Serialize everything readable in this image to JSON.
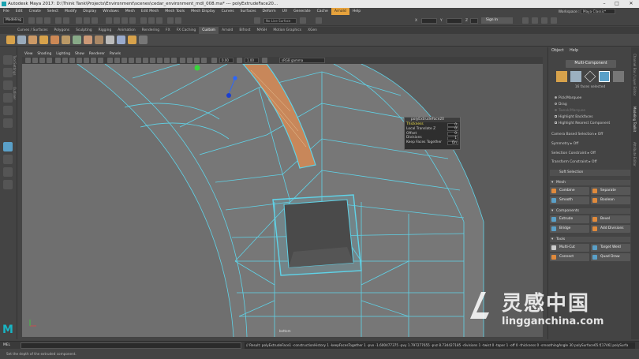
{
  "titlebar": {
    "text": "Autodesk Maya 2017: D:\\Think Tank\\Projects\\Environment\\scenes\\cedar_environment_mdl_008.ma* --- polyExtrudeFace20..."
  },
  "menu": {
    "items": [
      "File",
      "Edit",
      "Create",
      "Select",
      "Modify",
      "Display",
      "Windows",
      "Mesh",
      "Edit Mesh",
      "Mesh Tools",
      "Mesh Display",
      "Curves",
      "Surfaces",
      "Deform",
      "UV",
      "Generate",
      "Cache",
      "Arnold",
      "Help"
    ],
    "highlighted": "Arnold",
    "workspace_label": "Workspace :",
    "workspace_value": "Maya Classic*"
  },
  "status_line": {
    "mode": "Modeling",
    "live_surface": "No Live Surface",
    "x_label": "X",
    "y_label": "Y",
    "z_label": "Z",
    "sign_in": "Sign In"
  },
  "shelf": {
    "tabs": [
      "Curves / Surfaces",
      "Polygons",
      "Sculpting",
      "Rigging",
      "Animation",
      "Rendering",
      "FX",
      "FX Caching",
      "Custom",
      "Arnold",
      "Bifrost",
      "MASH",
      "Motion Graphics",
      "XGen"
    ],
    "active_tab": "Custom"
  },
  "viewport": {
    "menu": [
      "View",
      "Shading",
      "Lighting",
      "Show",
      "Renderer",
      "Panels"
    ],
    "field_near": "0.00",
    "field_far": "1.00",
    "color_space": "sRGB gamma",
    "camera_label": "bottom"
  },
  "hud": {
    "title": "polyExtrudeFace20",
    "rows": [
      {
        "label": "Thickness",
        "value": "0"
      },
      {
        "label": "Local Translate Z",
        "value": "0"
      },
      {
        "label": "Offset",
        "value": "0"
      },
      {
        "label": "Divisions",
        "value": "1"
      },
      {
        "label": "Keep Faces Together",
        "value": "On"
      }
    ]
  },
  "modeling_toolkit": {
    "menu": [
      "Object",
      "Help"
    ],
    "title": "Multi-Component",
    "faces_selected": "16 faces selected",
    "options": [
      {
        "label": "Pick/Marquee",
        "state": "radio-on"
      },
      {
        "label": "Drag",
        "state": "radio-off"
      },
      {
        "label": "Tweak/Marquee",
        "state": "dim"
      },
      {
        "label": "Highlight Backfaces",
        "state": "check"
      },
      {
        "label": "Highlight Nearest Component",
        "state": "check"
      }
    ],
    "dropdowns": [
      {
        "label": "Camera Based Selection",
        "value": "Off"
      },
      {
        "label": "Symmetry",
        "value": "Off"
      },
      {
        "label": "Selection Constraint",
        "value": "Off"
      },
      {
        "label": "Transform Constraint",
        "value": "Off"
      }
    ],
    "soft_selection": "Soft Selection",
    "sections": {
      "mesh": "Mesh",
      "components": "Components",
      "tools": "Tools"
    },
    "mesh_buttons": [
      "Combine",
      "Separate",
      "Smooth",
      "Boolean"
    ],
    "component_buttons": [
      "Extrude",
      "Bevel",
      "Bridge",
      "Add Divisions"
    ],
    "tool_buttons": [
      "Multi-Cut",
      "Target Weld",
      "Connect",
      "Quad Draw"
    ]
  },
  "side_tabs": [
    "Channel Box / Layer Editor",
    "Modeling Toolkit",
    "Attribute Editor"
  ],
  "left_tabs": [
    "Tool Settings",
    "Outliner"
  ],
  "command_line": {
    "label": "MEL",
    "result": "// Result: polyExtrudeFace1 -constructionHistory 1 -keepFacesTogether 1 -pvx -1.600477375 -pvy 1.797277655 -pvz 8.734427185 -divisions 1 -twist 0 -taper 1 -off 0 -thickness 0 -smoothingAngle 30 polySurface65.f[1746] polySurfa"
  },
  "help_line": "Set the depth of the extruded component.",
  "watermark": {
    "cn": "灵感中国",
    "en": "lingganchina.com"
  },
  "colors": {
    "accent": "#e6a23c",
    "mesh_wire": "#5fd3e8",
    "selected_face": "#c8875a",
    "viewport_bg": "#6b6b6b",
    "brand": "#19b4c3"
  }
}
